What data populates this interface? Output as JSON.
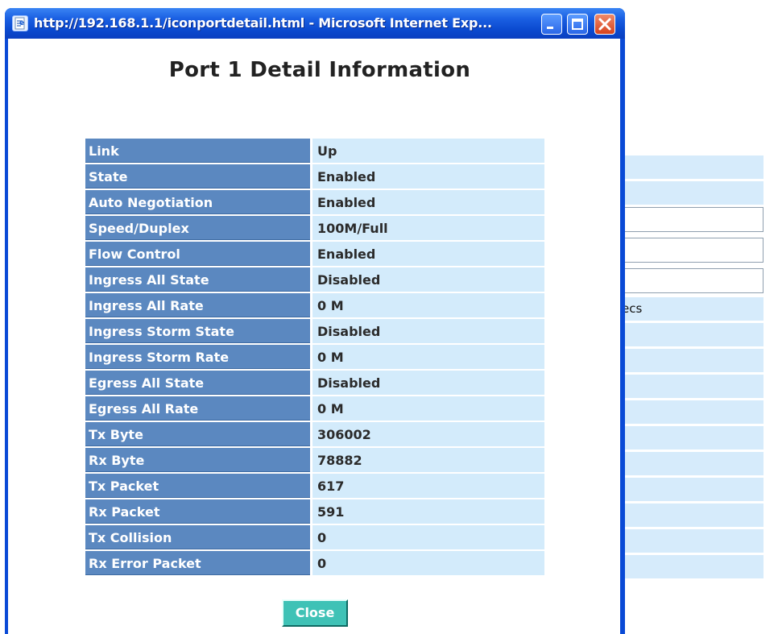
{
  "window": {
    "title": "http://192.168.1.1/iconportdetail.html - Microsoft Internet Exp...",
    "buttons": [
      "minimize",
      "maximize",
      "close"
    ]
  },
  "page": {
    "title": "Port 1 Detail Information",
    "close_label": "Close"
  },
  "rows": [
    {
      "label": "Link",
      "value": "Up"
    },
    {
      "label": "State",
      "value": "Enabled"
    },
    {
      "label": "Auto Negotiation",
      "value": "Enabled"
    },
    {
      "label": "Speed/Duplex",
      "value": "100M/Full"
    },
    {
      "label": "Flow Control",
      "value": "Enabled"
    },
    {
      "label": "Ingress All State",
      "value": "Disabled"
    },
    {
      "label": "Ingress All Rate",
      "value": "0 M"
    },
    {
      "label": "Ingress Storm State",
      "value": "Disabled"
    },
    {
      "label": "Ingress Storm Rate",
      "value": "0 M"
    },
    {
      "label": "Egress All State",
      "value": "Disabled"
    },
    {
      "label": "Egress All Rate",
      "value": "0 M"
    },
    {
      "label": "Tx Byte",
      "value": "306002"
    },
    {
      "label": "Rx Byte",
      "value": "78882"
    },
    {
      "label": "Tx Packet",
      "value": "617"
    },
    {
      "label": "Rx Packet",
      "value": "591"
    },
    {
      "label": "Tx Collision",
      "value": "0"
    },
    {
      "label": "Rx Error Packet",
      "value": "0"
    }
  ],
  "background_page": {
    "partial_text": "ecs"
  },
  "colors": {
    "label_bg": "#5b88c0",
    "value_bg": "#d3ebfb",
    "close_button": "#3fc2b6",
    "titlebar": "#1a5fe2"
  },
  "icons": [
    "ie-page-icon",
    "minimize-icon",
    "maximize-icon",
    "close-icon"
  ]
}
